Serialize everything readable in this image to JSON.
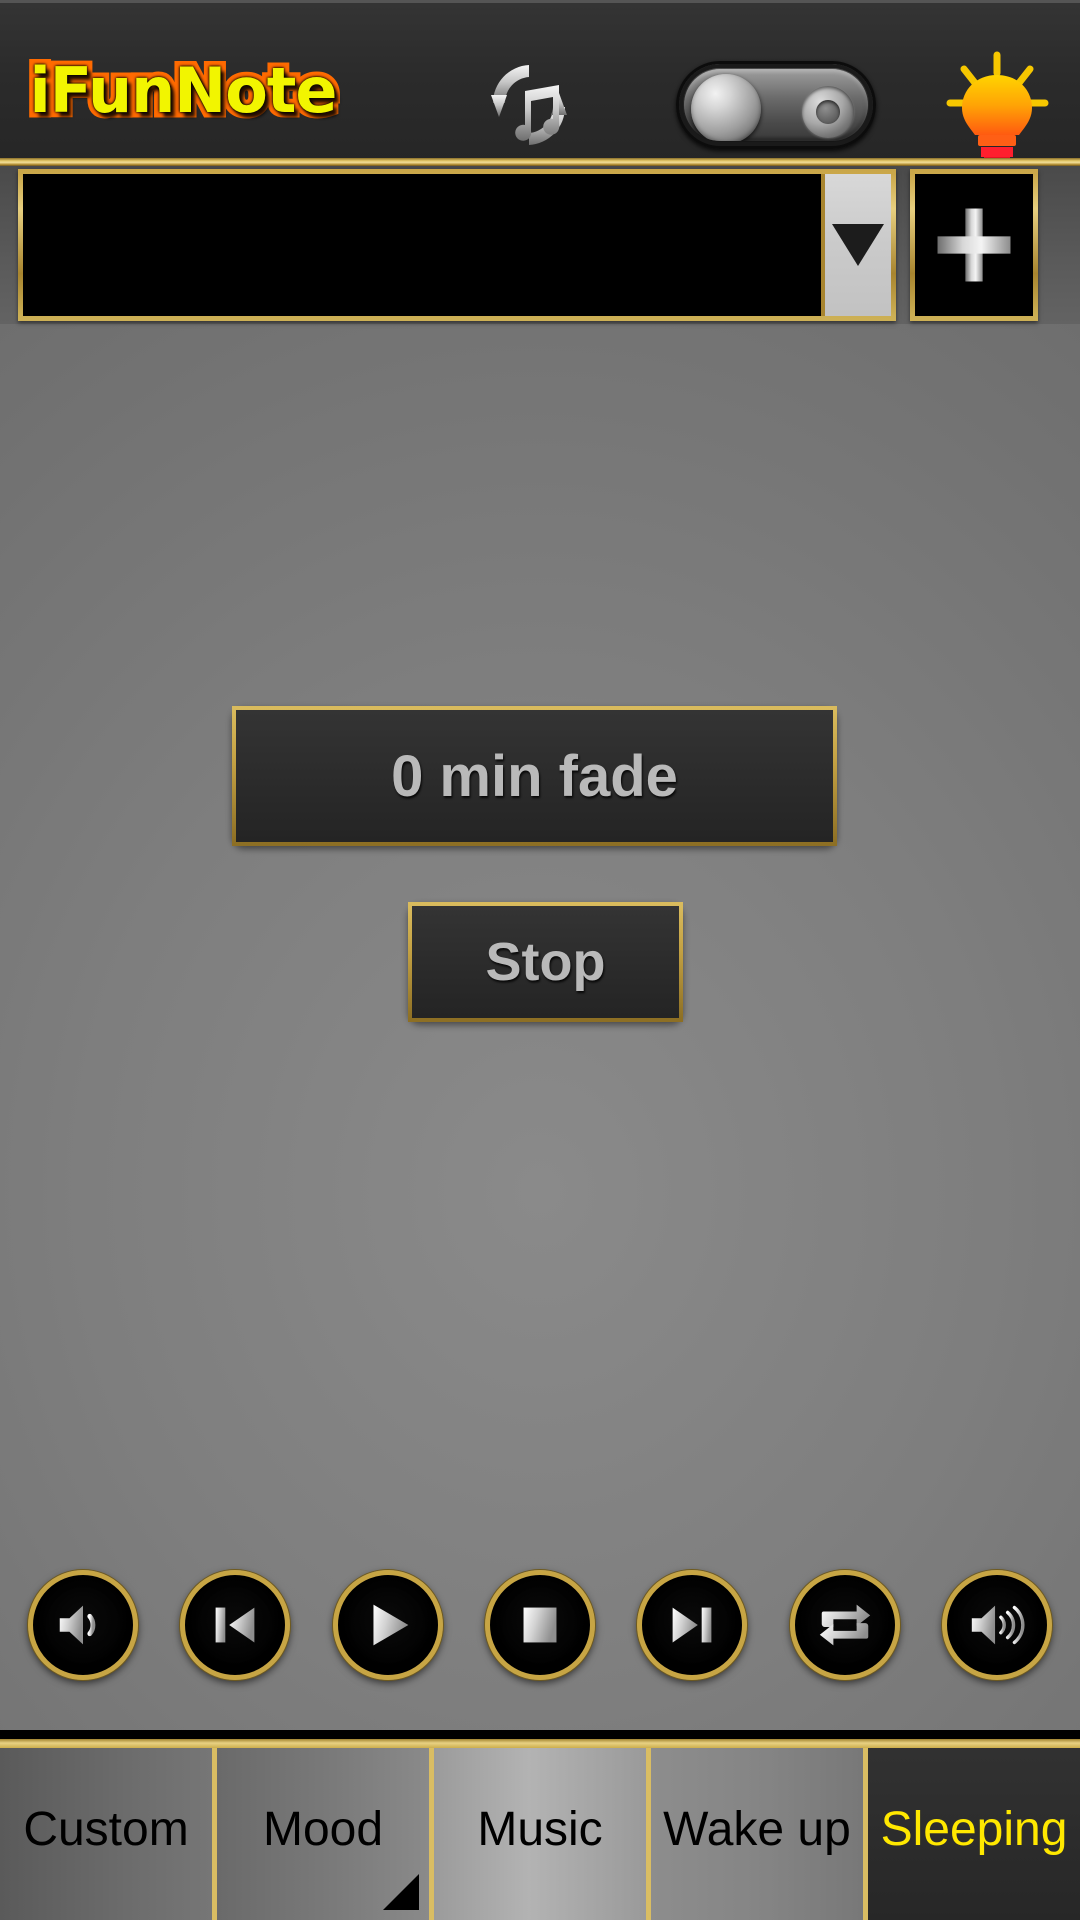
{
  "app": {
    "title": "iFunNote",
    "accent_gold": "#c9a648",
    "accent_yellow": "#ffe800",
    "logo_fill": "#f2f500",
    "logo_stroke": "#ff6a00",
    "background_gray": "#7e7e7e",
    "panel_dark": "#2b2b2b"
  },
  "header": {
    "logo_text": "iFunNote",
    "refresh_icon": "refresh-music-icon",
    "toggle": {
      "name": "power-toggle",
      "state": "off"
    },
    "bulb_icon": "lightbulb-icon"
  },
  "select_row": {
    "combo": {
      "value": "",
      "placeholder": "",
      "arrow_icon": "chevron-down-icon"
    },
    "add_button": {
      "label": "+",
      "icon": "plus-icon"
    }
  },
  "main": {
    "fade_button_label": "0 min fade",
    "stop_button_label": "Stop"
  },
  "media_controls": [
    {
      "name": "volume-down-button",
      "icon": "volume-low-icon"
    },
    {
      "name": "previous-track-button",
      "icon": "skip-previous-icon"
    },
    {
      "name": "play-button",
      "icon": "play-icon"
    },
    {
      "name": "stop-button",
      "icon": "stop-square-icon"
    },
    {
      "name": "next-track-button",
      "icon": "skip-next-icon"
    },
    {
      "name": "repeat-button",
      "icon": "repeat-icon"
    },
    {
      "name": "volume-up-button",
      "icon": "volume-high-icon"
    }
  ],
  "tabs": [
    {
      "label": "Custom",
      "active": false,
      "corner": false
    },
    {
      "label": "Mood",
      "active": false,
      "corner": true
    },
    {
      "label": "Music",
      "active": false,
      "corner": false
    },
    {
      "label": "Wake up",
      "active": false,
      "corner": false
    },
    {
      "label": "Sleeping",
      "active": true,
      "corner": false
    }
  ]
}
